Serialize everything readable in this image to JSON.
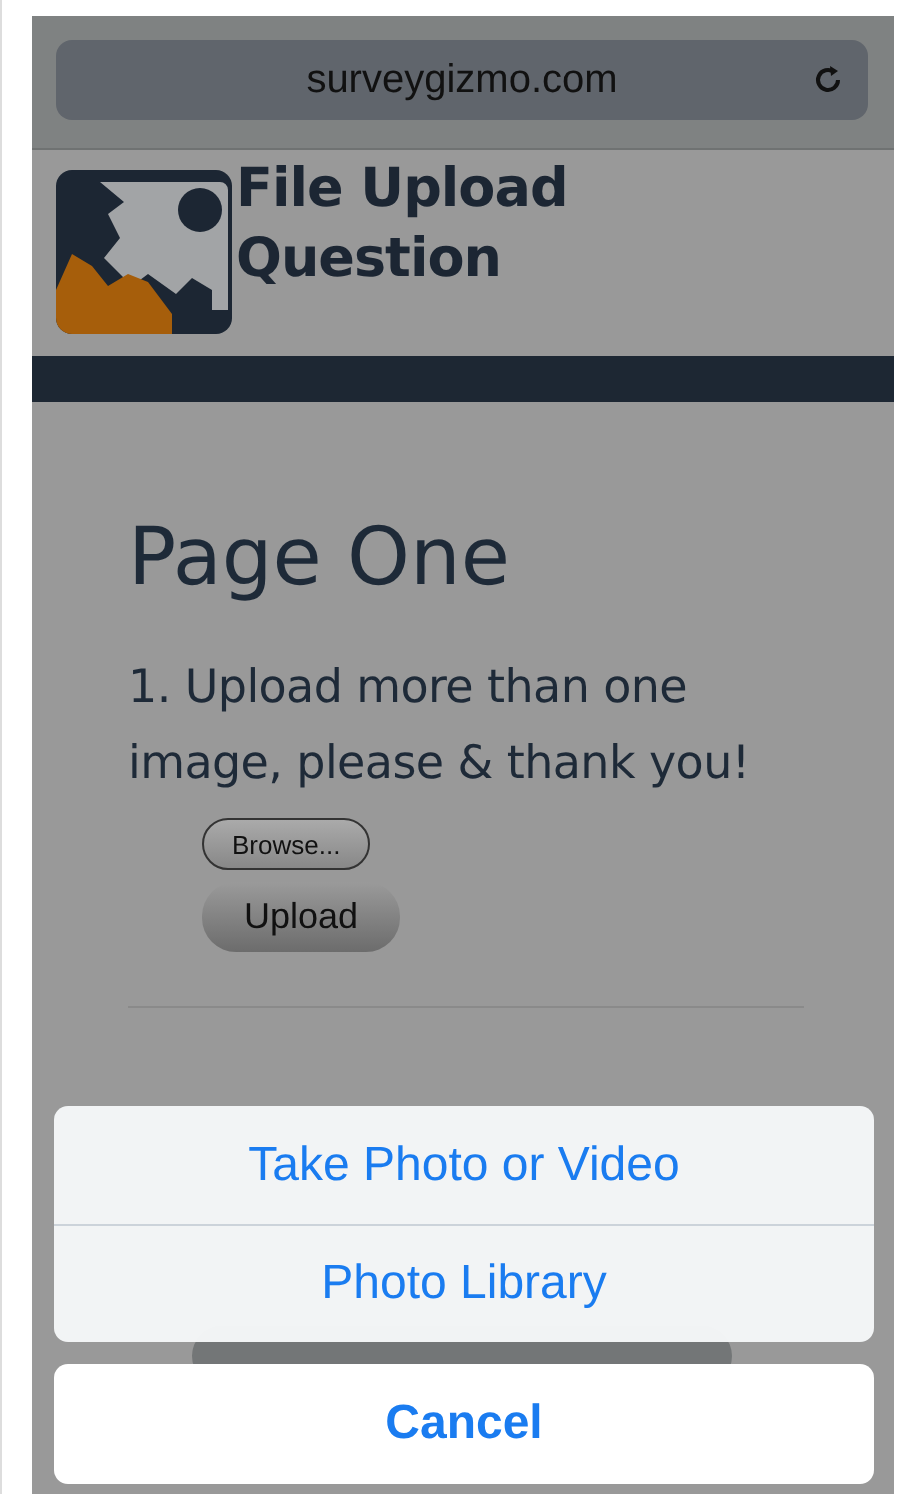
{
  "browser": {
    "address": "surveygizmo.com"
  },
  "header": {
    "title": "File Upload Question"
  },
  "page": {
    "heading": "Page One",
    "question": "1. Upload more than one image, please & thank you!",
    "browse_button": "Browse...",
    "upload_button": "Upload"
  },
  "action_sheet": {
    "options": [
      {
        "label": "Take Photo or Video"
      },
      {
        "label": "Photo Library"
      }
    ],
    "cancel": "Cancel"
  }
}
